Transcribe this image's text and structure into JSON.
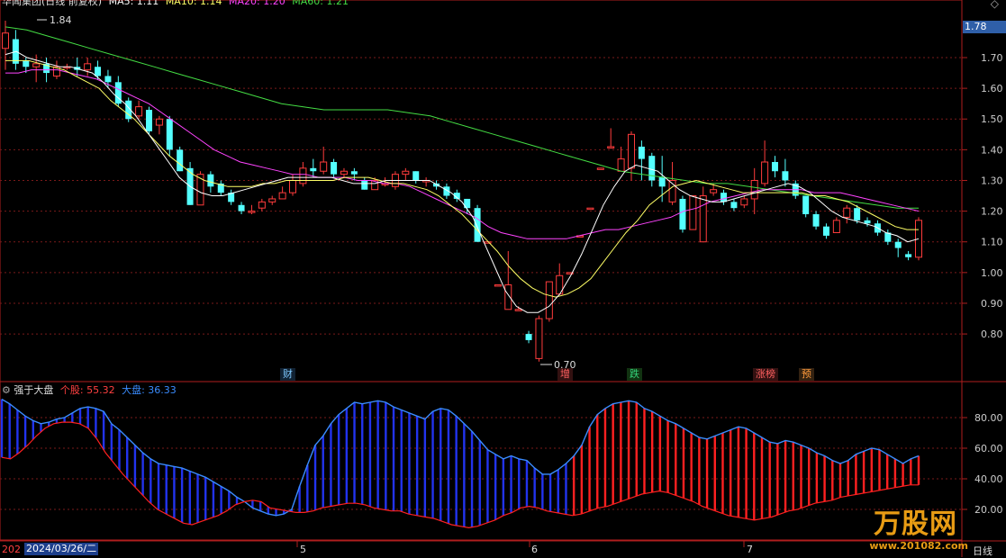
{
  "header": {
    "title": "华闻集团(日线 前复权)",
    "ma5": "MA5: 1.11",
    "ma10": "MA10: 1.14",
    "ma20": "MA20: 1.20",
    "ma60": "MA60: 1.21"
  },
  "lower_header": {
    "name": "强于大盘",
    "stock": "个股: 55.32",
    "market": "大盘: 36.33"
  },
  "price_tag": "1.78",
  "footer": {
    "left_stub": "202",
    "date": "2024/03/26/二",
    "months": [
      "5",
      "6",
      "7"
    ],
    "period": "日线"
  },
  "badges": [
    {
      "text": "财",
      "color": "#7ec8ff"
    },
    {
      "text": "增",
      "color": "#ff6060"
    },
    {
      "text": "跌",
      "color": "#33d17a"
    },
    {
      "text": "涨榜",
      "color": "#ff6060"
    },
    {
      "text": "预",
      "color": "#ff9a3c"
    }
  ],
  "watermark": {
    "brand": "万股网",
    "url": "www.201082.com"
  },
  "colors": {
    "up": "#ff3c3c",
    "down": "#54ffff",
    "ma5": "#ffffff",
    "ma10": "#ffff66",
    "ma20": "#ff44ff",
    "ma60": "#44dd44",
    "grid": "#7a1a1a",
    "axis": "#b01e1e",
    "stock_bar": "#ff2020",
    "market_bar": "#2233ee",
    "market_line": "#3a8cff",
    "stock_line": "#ff2020"
  },
  "chart_data": {
    "type": "candlestick",
    "y_ticks": [
      "1.70",
      "1.60",
      "1.50",
      "1.40",
      "1.30",
      "1.20",
      "1.10",
      "1.00",
      "0.90",
      "0.80"
    ],
    "ylim": [
      0.7,
      1.84
    ],
    "high_label": "1.84",
    "low_label": "0.70",
    "candles": [
      [
        1.73,
        1.78,
        1.82,
        1.66
      ],
      [
        1.76,
        1.68,
        1.79,
        1.66
      ],
      [
        1.69,
        1.67,
        1.7,
        1.65
      ],
      [
        1.67,
        1.68,
        1.71,
        1.62
      ],
      [
        1.68,
        1.65,
        1.7,
        1.62
      ],
      [
        1.64,
        1.67,
        1.69,
        1.63
      ],
      [
        1.67,
        1.67,
        1.68,
        1.66
      ],
      [
        1.67,
        1.66,
        1.7,
        1.64
      ],
      [
        1.66,
        1.68,
        1.7,
        1.64
      ],
      [
        1.67,
        1.64,
        1.69,
        1.63
      ],
      [
        1.64,
        1.62,
        1.66,
        1.6
      ],
      [
        1.62,
        1.55,
        1.64,
        1.54
      ],
      [
        1.56,
        1.5,
        1.57,
        1.49
      ],
      [
        1.51,
        1.54,
        1.56,
        1.5
      ],
      [
        1.53,
        1.46,
        1.54,
        1.45
      ],
      [
        1.48,
        1.5,
        1.51,
        1.45
      ],
      [
        1.5,
        1.4,
        1.51,
        1.38
      ],
      [
        1.4,
        1.33,
        1.41,
        1.33
      ],
      [
        1.34,
        1.22,
        1.36,
        1.22
      ],
      [
        1.22,
        1.32,
        1.33,
        1.22
      ],
      [
        1.32,
        1.28,
        1.33,
        1.26
      ],
      [
        1.29,
        1.26,
        1.3,
        1.25
      ],
      [
        1.26,
        1.23,
        1.27,
        1.22
      ],
      [
        1.22,
        1.2,
        1.23,
        1.19
      ],
      [
        1.2,
        1.2,
        1.22,
        1.19
      ],
      [
        1.21,
        1.23,
        1.24,
        1.2
      ],
      [
        1.23,
        1.24,
        1.25,
        1.22
      ],
      [
        1.24,
        1.26,
        1.28,
        1.24
      ],
      [
        1.26,
        1.3,
        1.32,
        1.25
      ],
      [
        1.29,
        1.34,
        1.36,
        1.28
      ],
      [
        1.34,
        1.33,
        1.37,
        1.31
      ],
      [
        1.33,
        1.36,
        1.41,
        1.32
      ],
      [
        1.36,
        1.32,
        1.37,
        1.31
      ],
      [
        1.32,
        1.33,
        1.34,
        1.31
      ],
      [
        1.33,
        1.32,
        1.34,
        1.3
      ],
      [
        1.3,
        1.27,
        1.31,
        1.27
      ],
      [
        1.27,
        1.3,
        1.31,
        1.27
      ],
      [
        1.29,
        1.29,
        1.31,
        1.28
      ],
      [
        1.28,
        1.32,
        1.33,
        1.27
      ],
      [
        1.32,
        1.33,
        1.34,
        1.3
      ],
      [
        1.33,
        1.3,
        1.33,
        1.29
      ],
      [
        1.3,
        1.3,
        1.31,
        1.28
      ],
      [
        1.29,
        1.28,
        1.3,
        1.27
      ],
      [
        1.28,
        1.25,
        1.29,
        1.24
      ],
      [
        1.26,
        1.24,
        1.27,
        1.23
      ],
      [
        1.24,
        1.21,
        1.24,
        1.19
      ],
      [
        1.21,
        1.1,
        1.22,
        1.1
      ],
      [
        1.1,
        1.1,
        1.1,
        1.1
      ],
      [
        0.96,
        0.96,
        0.96,
        0.96
      ],
      [
        0.88,
        0.96,
        1.07,
        0.88
      ],
      [
        0.88,
        0.88,
        0.89,
        0.88
      ],
      [
        0.8,
        0.78,
        0.81,
        0.77
      ],
      [
        0.72,
        0.85,
        0.86,
        0.71
      ],
      [
        0.85,
        0.97,
        0.97,
        0.84
      ],
      [
        0.93,
        0.99,
        1.03,
        0.93
      ],
      [
        1.0,
        1.0,
        1.0,
        1.0
      ],
      [
        1.12,
        1.12,
        1.12,
        1.12
      ],
      [
        1.21,
        1.21,
        1.21,
        1.21
      ],
      [
        1.34,
        1.34,
        1.34,
        1.34
      ],
      [
        1.41,
        1.41,
        1.47,
        1.41
      ],
      [
        1.33,
        1.37,
        1.41,
        1.33
      ],
      [
        1.34,
        1.45,
        1.46,
        1.3
      ],
      [
        1.41,
        1.37,
        1.43,
        1.3
      ],
      [
        1.38,
        1.3,
        1.39,
        1.28
      ],
      [
        1.31,
        1.28,
        1.38,
        1.23
      ],
      [
        1.23,
        1.3,
        1.36,
        1.22
      ],
      [
        1.24,
        1.14,
        1.25,
        1.13
      ],
      [
        1.14,
        1.25,
        1.25,
        1.14
      ],
      [
        1.1,
        1.25,
        1.28,
        1.1
      ],
      [
        1.26,
        1.27,
        1.29,
        1.25
      ],
      [
        1.26,
        1.23,
        1.27,
        1.22
      ],
      [
        1.23,
        1.21,
        1.24,
        1.2
      ],
      [
        1.22,
        1.24,
        1.25,
        1.21
      ],
      [
        1.24,
        1.3,
        1.34,
        1.19
      ],
      [
        1.29,
        1.36,
        1.43,
        1.28
      ],
      [
        1.36,
        1.33,
        1.38,
        1.31
      ],
      [
        1.33,
        1.3,
        1.37,
        1.28
      ],
      [
        1.29,
        1.25,
        1.3,
        1.24
      ],
      [
        1.25,
        1.19,
        1.25,
        1.18
      ],
      [
        1.19,
        1.15,
        1.2,
        1.14
      ],
      [
        1.15,
        1.12,
        1.16,
        1.11
      ],
      [
        1.13,
        1.17,
        1.18,
        1.13
      ],
      [
        1.18,
        1.21,
        1.22,
        1.16
      ],
      [
        1.21,
        1.17,
        1.22,
        1.16
      ],
      [
        1.17,
        1.16,
        1.18,
        1.15
      ],
      [
        1.16,
        1.13,
        1.17,
        1.12
      ],
      [
        1.13,
        1.1,
        1.14,
        1.09
      ],
      [
        1.1,
        1.08,
        1.11,
        1.05
      ],
      [
        1.06,
        1.05,
        1.07,
        1.04
      ],
      [
        1.05,
        1.17,
        1.18,
        1.04
      ]
    ],
    "ma5": [
      1.71,
      1.72,
      1.7,
      1.69,
      1.68,
      1.67,
      1.67,
      1.66,
      1.65,
      1.62,
      1.58,
      1.55,
      1.51,
      1.46,
      1.41,
      1.36,
      1.31,
      1.28,
      1.26,
      1.25,
      1.25,
      1.26,
      1.27,
      1.28,
      1.29,
      1.3,
      1.31,
      1.31,
      1.31,
      1.31,
      1.31,
      1.3,
      1.29,
      1.29,
      1.29,
      1.3,
      1.3,
      1.3,
      1.3,
      1.3,
      1.28,
      1.26,
      1.23,
      1.18,
      1.1,
      1.02,
      0.94,
      0.89,
      0.87,
      0.87,
      0.89,
      0.93,
      0.99,
      1.06,
      1.14,
      1.22,
      1.28,
      1.33,
      1.35,
      1.34,
      1.33,
      1.3,
      1.27,
      1.25,
      1.24,
      1.23,
      1.23,
      1.24,
      1.25,
      1.26,
      1.27,
      1.28,
      1.29,
      1.28,
      1.26,
      1.23,
      1.2,
      1.18,
      1.17,
      1.16,
      1.15,
      1.13,
      1.12,
      1.1,
      1.11
    ],
    "ma10": [
      1.69,
      1.69,
      1.69,
      1.68,
      1.67,
      1.66,
      1.64,
      1.62,
      1.6,
      1.56,
      1.53,
      1.5,
      1.46,
      1.42,
      1.38,
      1.35,
      1.32,
      1.3,
      1.29,
      1.28,
      1.28,
      1.28,
      1.29,
      1.29,
      1.3,
      1.3,
      1.3,
      1.3,
      1.3,
      1.31,
      1.31,
      1.31,
      1.3,
      1.29,
      1.29,
      1.28,
      1.27,
      1.25,
      1.22,
      1.19,
      1.15,
      1.11,
      1.07,
      1.02,
      0.98,
      0.95,
      0.93,
      0.92,
      0.93,
      0.95,
      0.98,
      1.03,
      1.08,
      1.13,
      1.17,
      1.22,
      1.25,
      1.28,
      1.29,
      1.3,
      1.29,
      1.28,
      1.27,
      1.26,
      1.26,
      1.26,
      1.26,
      1.26,
      1.26,
      1.25,
      1.25,
      1.24,
      1.23,
      1.21,
      1.19,
      1.17,
      1.15,
      1.14,
      1.14
    ],
    "ma20": [
      1.65,
      1.65,
      1.66,
      1.66,
      1.66,
      1.65,
      1.64,
      1.63,
      1.61,
      1.59,
      1.57,
      1.55,
      1.52,
      1.49,
      1.46,
      1.43,
      1.4,
      1.38,
      1.36,
      1.35,
      1.34,
      1.33,
      1.32,
      1.32,
      1.31,
      1.31,
      1.31,
      1.3,
      1.3,
      1.29,
      1.29,
      1.28,
      1.26,
      1.24,
      1.22,
      1.2,
      1.18,
      1.15,
      1.13,
      1.12,
      1.11,
      1.11,
      1.11,
      1.11,
      1.12,
      1.13,
      1.14,
      1.14,
      1.15,
      1.16,
      1.17,
      1.18,
      1.2,
      1.21,
      1.23,
      1.24,
      1.25,
      1.26,
      1.27,
      1.27,
      1.27,
      1.27,
      1.26,
      1.26,
      1.26,
      1.25,
      1.24,
      1.23,
      1.22,
      1.21,
      1.2
    ],
    "ma60": [
      1.8,
      1.79,
      1.77,
      1.75,
      1.73,
      1.71,
      1.69,
      1.67,
      1.65,
      1.63,
      1.61,
      1.59,
      1.57,
      1.55,
      1.54,
      1.53,
      1.53,
      1.53,
      1.53,
      1.52,
      1.51,
      1.49,
      1.47,
      1.45,
      1.43,
      1.41,
      1.39,
      1.37,
      1.35,
      1.33,
      1.32,
      1.31,
      1.3,
      1.29,
      1.29,
      1.28,
      1.27,
      1.26,
      1.25,
      1.24,
      1.23,
      1.22,
      1.21,
      1.21
    ],
    "indicator": {
      "y_ticks": [
        "80.00",
        "60.00",
        "40.00",
        "20.00"
      ],
      "ylim": [
        0,
        100
      ],
      "stock": [
        92,
        89,
        85,
        81,
        78,
        76,
        77,
        79,
        80,
        83,
        86,
        87,
        86,
        84,
        76,
        72,
        67,
        62,
        57,
        53,
        50,
        49,
        48,
        47,
        45,
        43,
        41,
        38,
        35,
        32,
        28,
        25,
        21,
        19,
        17,
        16,
        17,
        20,
        35,
        49,
        62,
        68,
        76,
        82,
        86,
        90,
        89,
        90,
        91,
        90,
        87,
        85,
        83,
        81,
        79,
        84,
        86,
        85,
        81,
        76,
        71,
        65,
        59,
        56,
        53,
        55,
        53,
        52,
        47,
        43,
        43,
        46,
        50,
        55,
        62,
        74,
        82,
        86,
        89,
        90,
        91,
        90,
        86,
        84,
        81,
        78,
        76,
        73,
        70,
        67,
        66,
        68,
        70,
        72,
        74,
        73,
        70,
        67,
        64,
        63,
        65,
        64,
        62,
        60,
        57,
        55,
        52,
        50,
        52,
        56,
        58,
        60,
        59,
        56,
        53,
        50,
        53,
        55
      ],
      "market": [
        54,
        53,
        57,
        62,
        68,
        73,
        76,
        77,
        77,
        76,
        73,
        66,
        57,
        50,
        43,
        37,
        31,
        25,
        20,
        17,
        14,
        11,
        10,
        12,
        14,
        16,
        19,
        23,
        25,
        26,
        25,
        21,
        20,
        19,
        18,
        18,
        19,
        21,
        22,
        23,
        24,
        24,
        23,
        21,
        20,
        19,
        19,
        17,
        16,
        15,
        14,
        12,
        10,
        9,
        8,
        9,
        11,
        13,
        16,
        18,
        21,
        22,
        21,
        19,
        18,
        17,
        16,
        17,
        19,
        21,
        22,
        24,
        26,
        28,
        30,
        31,
        32,
        31,
        29,
        27,
        25,
        22,
        20,
        18,
        16,
        15,
        14,
        13,
        14,
        15,
        17,
        19,
        20,
        22,
        24,
        25,
        26,
        28,
        29,
        30,
        31,
        32,
        33,
        34,
        35,
        36,
        36
      ]
    }
  }
}
